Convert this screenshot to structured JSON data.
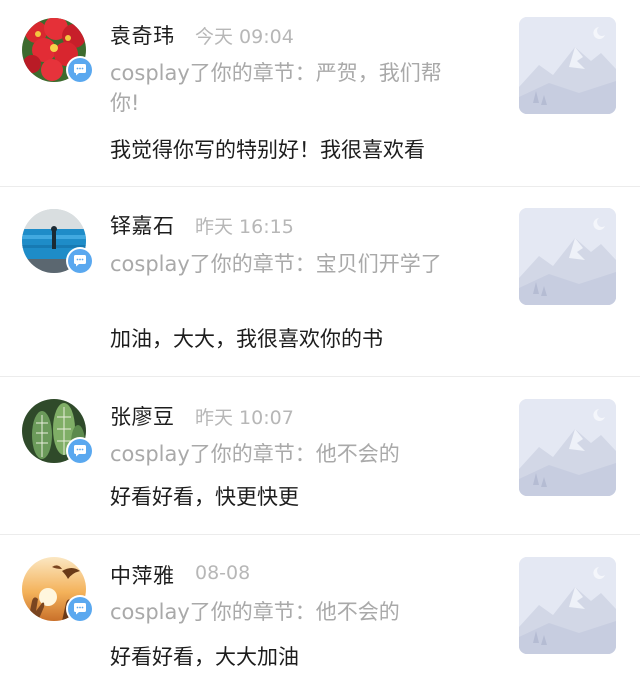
{
  "notifications": [
    {
      "user": "袁奇玮",
      "time": "今天 09:04",
      "action": "cosplay了你的章节：严贺，我们帮你!",
      "comment": "我觉得你写的特别好！我很喜欢看",
      "avatar": "red-flowers-avatar",
      "thumbnail": "mountain-placeholder-image"
    },
    {
      "user": "铎嘉石",
      "time": "昨天 16:15",
      "action": "cosplay了你的章节：宝贝们开学了",
      "comment": "加油，大大，我很喜欢你的书",
      "avatar": "ocean-person-avatar",
      "thumbnail": "mountain-placeholder-image"
    },
    {
      "user": "张廖豆",
      "time": "昨天 10:07",
      "action": "cosplay了你的章节：他不会的",
      "comment": "好看好看，快更快更",
      "avatar": "cactus-avatar",
      "thumbnail": "mountain-placeholder-image"
    },
    {
      "user": "中萍雅",
      "time": "08-08",
      "action": "cosplay了你的章节：他不会的",
      "comment": "好看好看，大大加油",
      "avatar": "sunset-hands-avatar",
      "thumbnail": "mountain-placeholder-image"
    }
  ],
  "colors": {
    "badge": "#5aa8ef",
    "action_text": "#a9a9a9",
    "time_text": "#b7b7b7",
    "thumbnail_bg": "#e4e8f3"
  }
}
